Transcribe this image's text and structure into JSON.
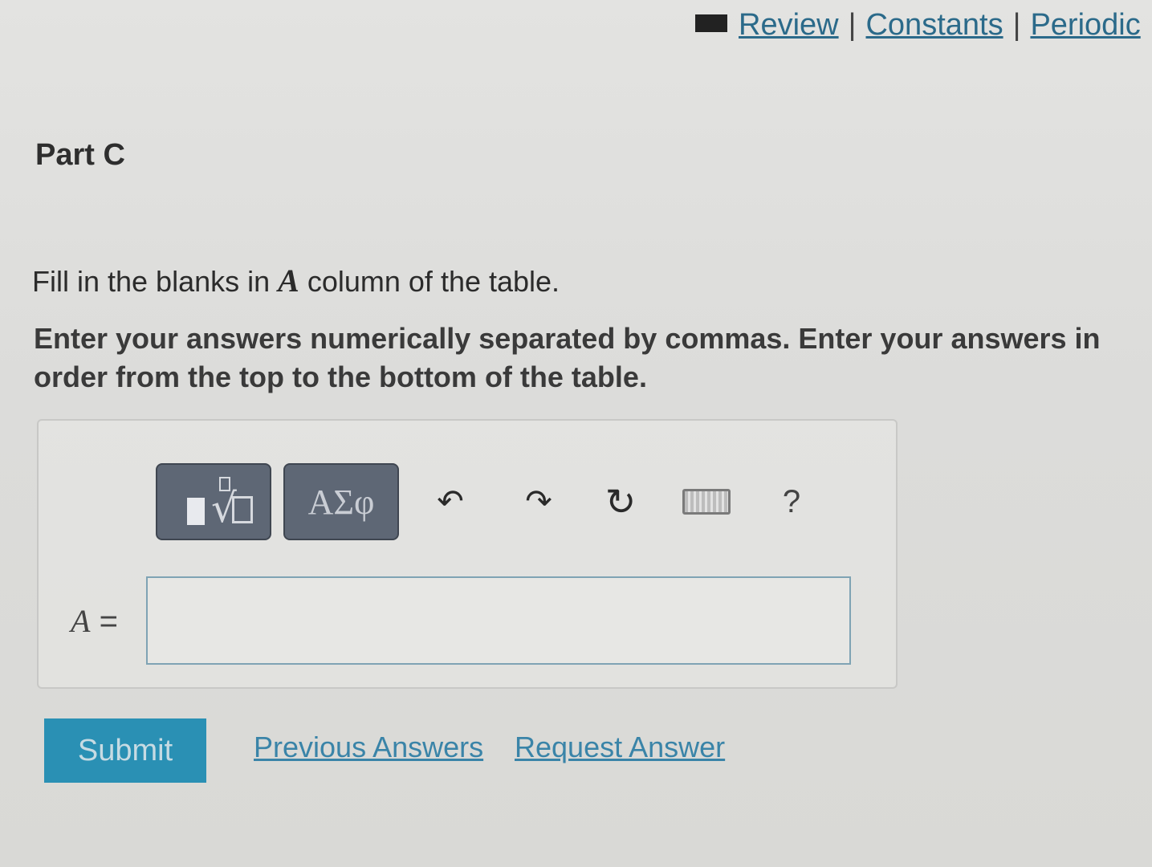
{
  "header": {
    "book_icon": "book-icon",
    "links": [
      "Review",
      "Constants",
      "Periodic"
    ],
    "separator": "|"
  },
  "part": {
    "title": "Part C"
  },
  "instructions": {
    "line1_prefix": "Fill in the blanks in",
    "line1_var": "A",
    "line1_suffix": "column of the table.",
    "line2": "Enter your answers numerically separated by commas. Enter your answers in order from the top to the bottom of the table."
  },
  "toolbar": {
    "templates_icon": "templates-radical-icon",
    "symbols_label": "ΑΣφ",
    "undo_icon": "↶",
    "redo_icon": "↷",
    "reset_icon": "↻",
    "keyboard_icon": "keyboard-icon",
    "help_label": "?"
  },
  "answer": {
    "variable": "A",
    "equals": "=",
    "value": "",
    "placeholder": ""
  },
  "actions": {
    "submit_label": "Submit",
    "previous_label": "Previous Answers",
    "request_label": "Request Answer"
  },
  "colors": {
    "submit_bg": "#2a90b4",
    "link": "#3a84a8",
    "toolbar_btn": "#5e6775"
  }
}
